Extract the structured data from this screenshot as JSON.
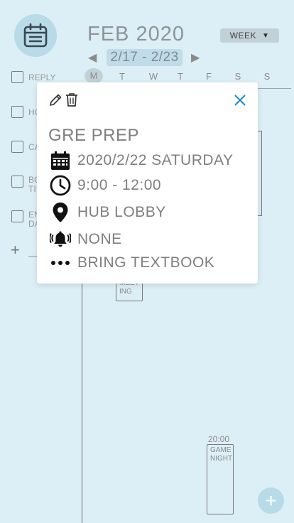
{
  "header": {
    "month_title": "FEB 2020",
    "view_mode": "WEEK",
    "week_range": "2/17 - 2/23",
    "prev_icon": "triangle-left-icon",
    "next_icon": "triangle-right-icon"
  },
  "days": [
    "M",
    "T",
    "W",
    "T",
    "F",
    "S",
    "S"
  ],
  "todos": [
    {
      "label": "REPLY"
    },
    {
      "label": "HO"
    },
    {
      "label": "CA"
    },
    {
      "label": "BO\nTI"
    },
    {
      "label": "EN\nDA"
    }
  ],
  "calendar": {
    "events": [
      {
        "label": "MEET\nING"
      },
      {
        "label": "GAME\nNIGHT",
        "time": "20:00"
      }
    ]
  },
  "popup": {
    "title": "GRE PREP",
    "date": "2020/2/22 SATURDAY",
    "time": "9:00 - 12:00",
    "location": "HUB LOBBY",
    "reminder": "NONE",
    "notes": "BRING TEXTBOOK",
    "close_color": "#1e88d6"
  },
  "colors": {
    "background": "#dceef6",
    "accent": "#b7dbe8"
  }
}
